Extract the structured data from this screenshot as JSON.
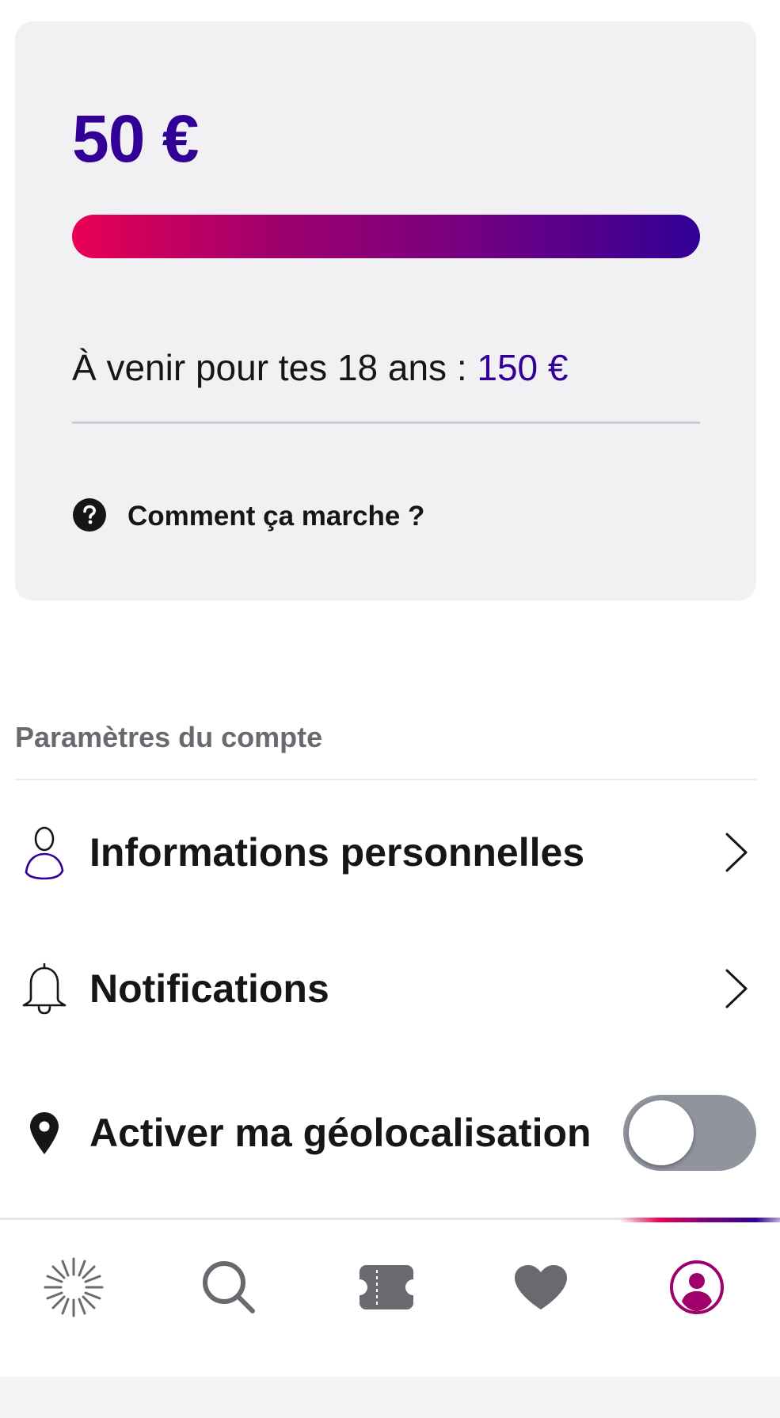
{
  "credit": {
    "amount": "50 €",
    "remaining_fraction": 1.0,
    "upcoming_label": "À venir pour tes 18 ans : ",
    "upcoming_amount": "150 €",
    "how_it_works": "Comment ça marche ?"
  },
  "settings": {
    "section_title": "Paramètres du compte",
    "items": [
      {
        "label": "Informations personnelles",
        "icon": "person-icon",
        "action": "chevron-right-icon"
      },
      {
        "label": "Notifications",
        "icon": "bell-icon",
        "action": "chevron-right-icon"
      },
      {
        "label": "Activer ma géolocalisation",
        "icon": "location-pin-icon",
        "toggle_on": false
      }
    ]
  },
  "tabbar": {
    "items": [
      {
        "name": "home",
        "icon": "sparkle-icon",
        "active": false
      },
      {
        "name": "search",
        "icon": "search-icon",
        "active": false
      },
      {
        "name": "bookings",
        "icon": "ticket-icon",
        "active": false
      },
      {
        "name": "favorites",
        "icon": "heart-icon",
        "active": false
      },
      {
        "name": "profile",
        "icon": "profile-icon",
        "active": true
      }
    ]
  },
  "colors": {
    "primary": "#320096",
    "accent": "#eb0055",
    "card_bg": "#f1f1f3",
    "toggle_off": "#90949d"
  }
}
